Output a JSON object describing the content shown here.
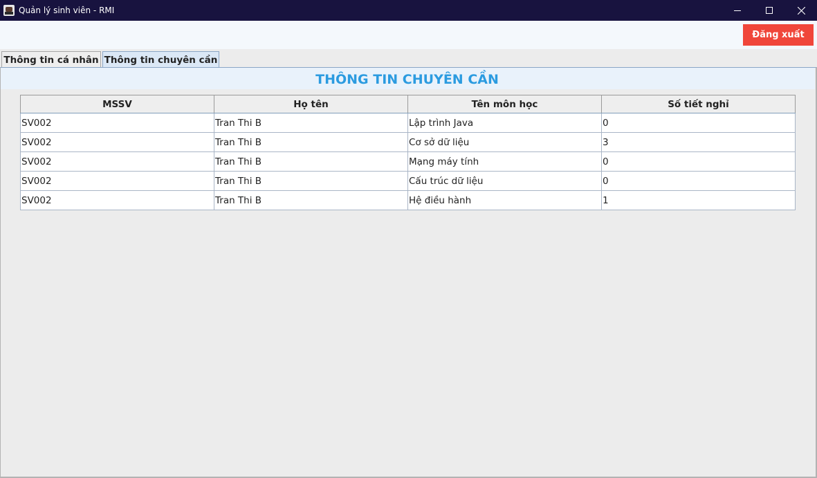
{
  "window": {
    "title": "Quản lý sinh viên - RMI",
    "title_bar_color": "#18133f"
  },
  "header": {
    "logout_label": "Đăng xuất",
    "logout_color": "#f0463a"
  },
  "tabs": [
    {
      "label": "Thông tin cá nhân",
      "selected": false
    },
    {
      "label": "Thông tin chuyên cần",
      "selected": true
    }
  ],
  "section": {
    "title": "THÔNG TIN CHUYÊN CẦN",
    "title_color": "#2b9be0"
  },
  "table": {
    "columns": [
      "MSSV",
      "Họ tên",
      "Tên môn học",
      "Số tiết nghỉ"
    ],
    "rows": [
      [
        "SV002",
        "Tran Thi B",
        "Lập trình Java",
        "0"
      ],
      [
        "SV002",
        "Tran Thi B",
        "Cơ sở dữ liệu",
        "3"
      ],
      [
        "SV002",
        "Tran Thi B",
        "Mạng máy tính",
        "0"
      ],
      [
        "SV002",
        "Tran Thi B",
        "Cấu trúc dữ liệu",
        "0"
      ],
      [
        "SV002",
        "Tran Thi B",
        "Hệ điều hành",
        "1"
      ]
    ]
  },
  "icons": {
    "app": "app-icon",
    "minimize": "minimize-icon",
    "maximize": "maximize-icon",
    "close": "close-icon"
  }
}
